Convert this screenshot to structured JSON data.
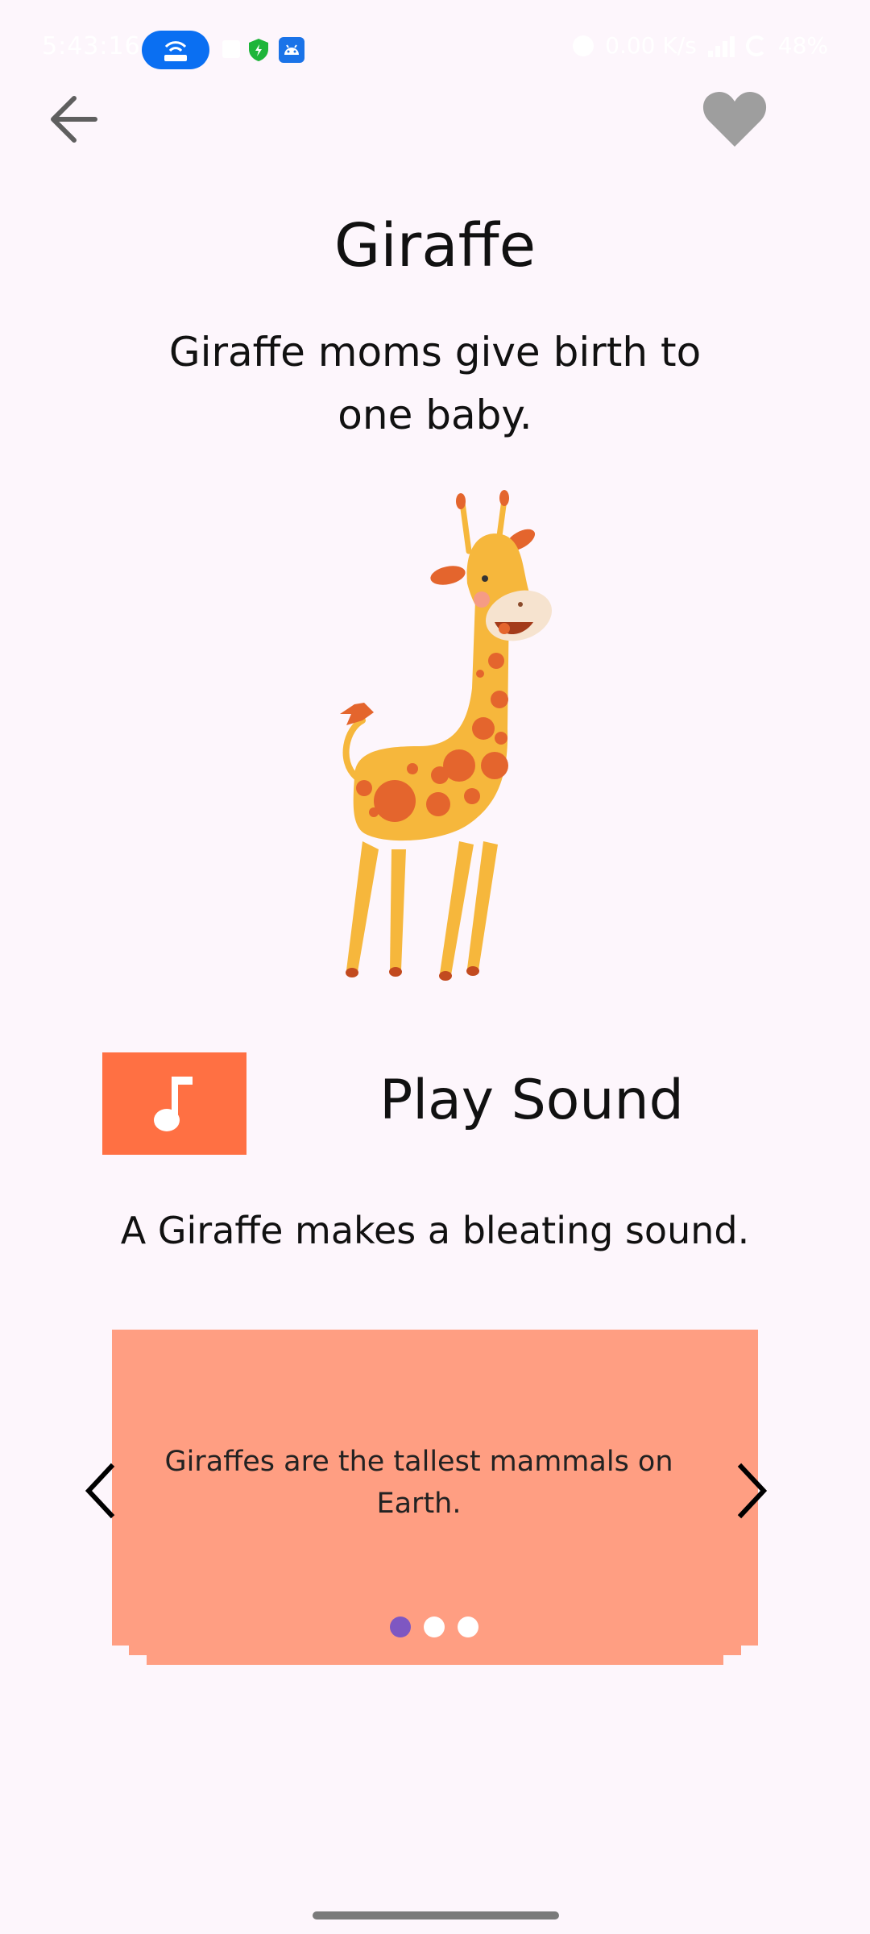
{
  "status_bar": {
    "time": "5:43:16",
    "net_speed": "0.00 K/s",
    "battery": "48%"
  },
  "header": {
    "back_icon": "arrow-left-icon",
    "favorite_icon": "heart-icon"
  },
  "animal": {
    "name": "Giraffe",
    "fact": "Giraffe moms give birth to one baby.",
    "image_icon": "giraffe-illustration"
  },
  "sound": {
    "button_icon": "music-note-icon",
    "label": "Play Sound",
    "description": "A Giraffe makes a bleating sound."
  },
  "carousel": {
    "fact_text": "Giraffes are the tallest mammals on Earth.",
    "page_count": 3,
    "active_index": 0,
    "prev_icon": "chevron-left-icon",
    "next_icon": "chevron-right-icon"
  },
  "colors": {
    "background": "#fdf6fc",
    "accent": "#ff7043",
    "card": "#ff9e82",
    "active_dot": "#7e57c2",
    "favorite_icon": "#9e9e9e"
  }
}
